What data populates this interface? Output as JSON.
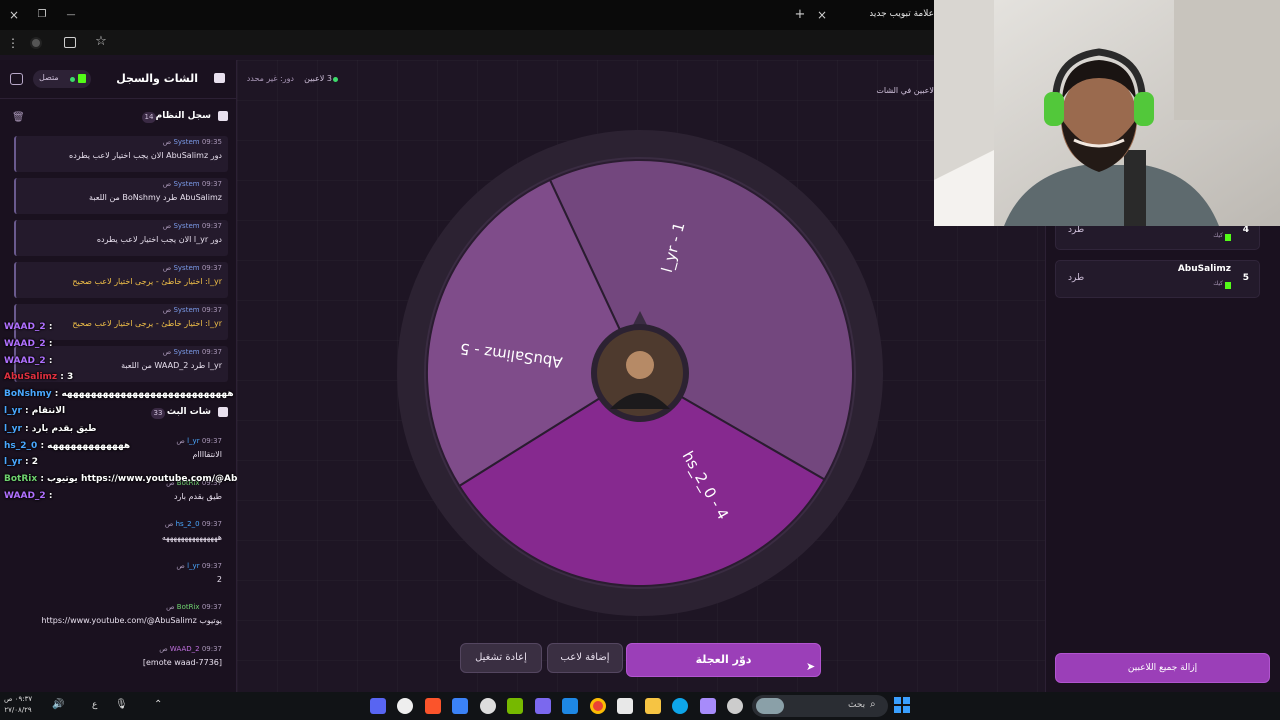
{
  "browser": {
    "tab_title": "علامة تبويب جديدة",
    "close_glyph": "×",
    "new_tab_glyph": "+",
    "minimize_glyph": "—",
    "restore_glyph": "❐",
    "window_close_glyph": "×",
    "menu_glyph": "⋮",
    "star_glyph": "☆"
  },
  "sidebar": {
    "title": "الشات والسجل",
    "status": "متصل",
    "system_log": {
      "title": "سجل النظام",
      "count": "14",
      "messages": [
        {
          "source": "System",
          "time": "09:35 ص",
          "text": "دور AbuSalimz الان يجب اختيار لاعب يطرده",
          "warn": false
        },
        {
          "source": "System",
          "time": "09:37 ص",
          "text": "AbuSalimz طرد BoNshmy من اللعبة",
          "warn": false
        },
        {
          "source": "System",
          "time": "09:37 ص",
          "text": "دور l_yr الان يجب اختيار لاعب يطرده",
          "warn": false
        },
        {
          "source": "System",
          "time": "09:37 ص",
          "text": "l_yr: اختيار خاطئ - يرجى اختيار لاعب صحيح",
          "warn": true
        },
        {
          "source": "System",
          "time": "09:37 ص",
          "text": "l_yr: اختيار خاطئ - يرجى اختيار لاعب صحيح",
          "warn": true
        },
        {
          "source": "System",
          "time": "09:37 ص",
          "text": "l_yr طرد WAAD_2 من اللعبة",
          "warn": false
        }
      ]
    },
    "live_chat": {
      "title": "شات البث",
      "count": "33",
      "messages": [
        {
          "user": "l_yr",
          "time": "09:37 ص",
          "text": "الانتقاااام",
          "color": "u"
        },
        {
          "user": "BotRix",
          "time": "09:37 ص",
          "text": "طيق بقدم بارد",
          "color": "u g"
        },
        {
          "user": "hs_2_0",
          "time": "09:37 ص",
          "text": "هههههههههههههههه",
          "color": "u"
        },
        {
          "user": "l_yr",
          "time": "09:37 ص",
          "text": "2",
          "color": "u"
        },
        {
          "user": "BotRix",
          "time": "09:37 ص",
          "text": "يوتيوب https://www.youtube.com/@AbuSalimz",
          "color": "u g"
        },
        {
          "user": "WAAD_2",
          "time": "09:37 ص",
          "text": "[emote waad-7736]",
          "color": "u p"
        }
      ]
    },
    "overlay": [
      {
        "user": "WAAD_2",
        "text": ":",
        "cls": "ov-user"
      },
      {
        "user": "WAAD_2",
        "text": ":",
        "cls": "ov-user"
      },
      {
        "user": "WAAD_2",
        "text": ":",
        "cls": "ov-user"
      },
      {
        "user": "AbuSalimz",
        "text": ": 3",
        "cls": "ov-user r"
      },
      {
        "user": "BoNshmy",
        "text": ": ههههههههههههههههههههههههههههه",
        "cls": "ov-user b"
      },
      {
        "user": "l_yr",
        "text": ": الانتقام",
        "cls": "ov-user b"
      },
      {
        "user": "l_yr",
        "text": ": طيق بقدم بارد",
        "cls": "ov-user b"
      },
      {
        "user": "hs_2_0",
        "text": ": هههههههههههههه",
        "cls": "ov-user b"
      },
      {
        "user": "l_yr",
        "text": ": 2",
        "cls": "ov-user b"
      },
      {
        "user": "BotRix",
        "text": ": يوتيوب https://www.youtube.com/@AbuSalimz",
        "cls": "ov-user g"
      },
      {
        "user": "WAAD_2",
        "text": ":",
        "cls": "ov-user"
      }
    ]
  },
  "main": {
    "players_count": "3 لاعبين",
    "turn": "دور: غير محدد",
    "right_hint": "لاعبين في الشات",
    "wheel": {
      "segments": [
        {
          "label": "l_yr - 1",
          "color": "#73477e"
        },
        {
          "label": "hs_2_0 - 4",
          "color": "#86298f"
        },
        {
          "label": "AbuSalimz - 5",
          "color": "#7f4c8a"
        }
      ]
    },
    "buttons": {
      "spin": "دوّر العجلة",
      "add_player": "إضافة لاعب",
      "restart": "إعادة تشغيل"
    }
  },
  "right_panel": {
    "players": [
      {
        "name": "hs_2_0",
        "platform": "كيك",
        "number": "4",
        "kick": "طرد"
      },
      {
        "name": "AbuSalimz",
        "platform": "كيك",
        "number": "5",
        "kick": "طرد"
      }
    ],
    "remove_all": "إزالة جميع اللاعبين"
  },
  "taskbar": {
    "search": "بحث",
    "time": "٠٩:٣٧ ص",
    "date": "٢٧/٠٨/٢٩"
  }
}
